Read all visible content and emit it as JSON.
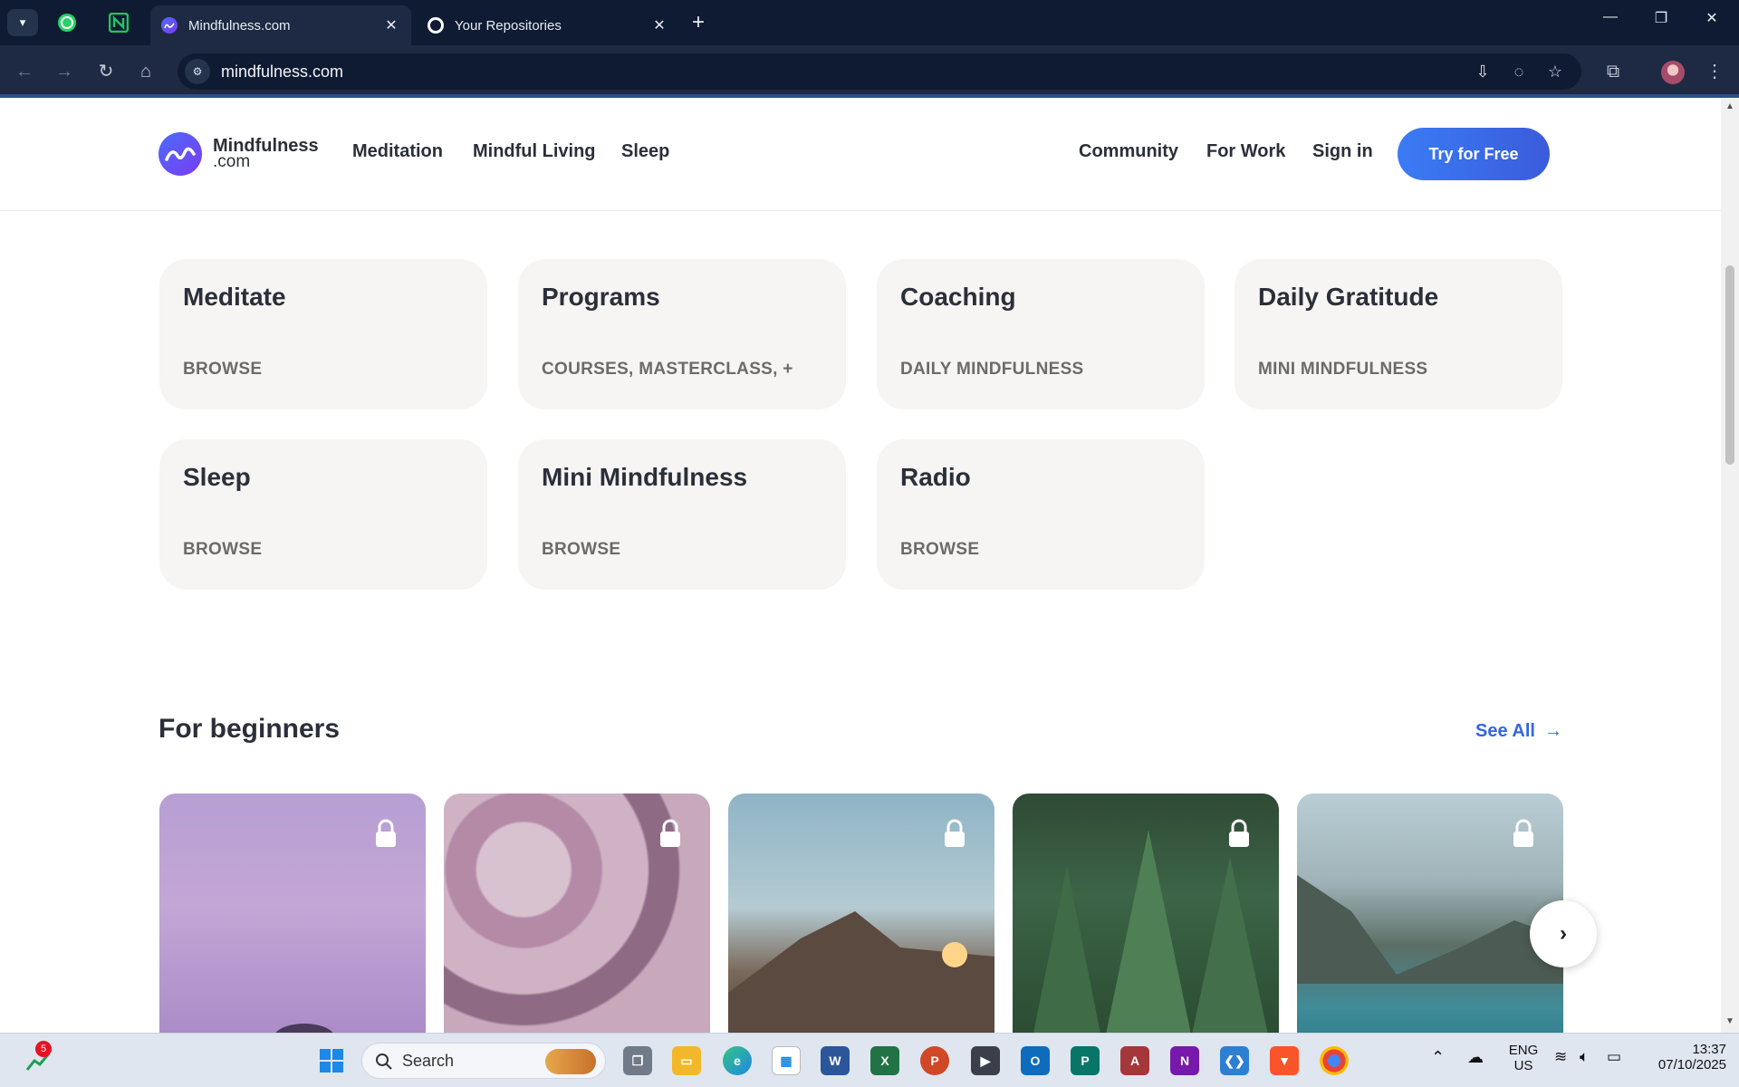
{
  "browser": {
    "tabs": [
      {
        "title": "Mindfulness.com",
        "active": true
      },
      {
        "title": "Your Repositories",
        "active": false
      }
    ],
    "url": "mindfulness.com"
  },
  "site": {
    "logo": {
      "line1": "Mindfulness",
      "line2": ".com"
    },
    "nav_left": [
      "Meditation",
      "Mindful Living",
      "Sleep"
    ],
    "nav_right": [
      "Community",
      "For Work",
      "Sign in"
    ],
    "cta": "Try for Free"
  },
  "categories": [
    {
      "title": "Meditate",
      "subtitle": "BROWSE"
    },
    {
      "title": "Programs",
      "subtitle": "COURSES, MASTERCLASS, +"
    },
    {
      "title": "Coaching",
      "subtitle": "DAILY MINDFULNESS"
    },
    {
      "title": "Daily Gratitude",
      "subtitle": "MINI MINDFULNESS"
    },
    {
      "title": "Sleep",
      "subtitle": "BROWSE"
    },
    {
      "title": "Mini Mindfulness",
      "subtitle": "BROWSE"
    },
    {
      "title": "Radio",
      "subtitle": "BROWSE"
    }
  ],
  "beginners": {
    "title": "For beginners",
    "see_all": "See All"
  },
  "taskbar": {
    "search_label": "Search",
    "notification_count": "5",
    "lang_line1": "ENG",
    "lang_line2": "US",
    "time": "13:37",
    "date": "07/10/2025"
  },
  "colors": {
    "brand_blue": "#3a7cf5",
    "link_blue": "#3366e0",
    "card_bg": "#f6f5f3",
    "chrome_dark": "#0f1b33"
  }
}
